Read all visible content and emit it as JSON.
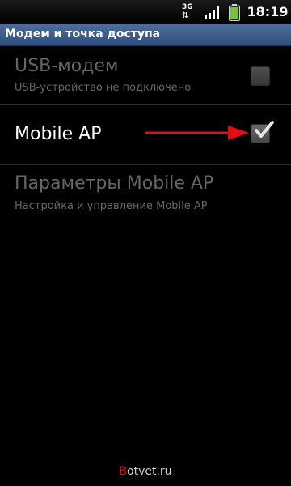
{
  "status_bar": {
    "network_type": "3G",
    "network_arrows": "⇅",
    "time": "18:19",
    "icons": [
      "network-3g-icon",
      "signal-strength-icon",
      "battery-icon"
    ],
    "battery_color": "#76c043"
  },
  "header": {
    "title": "Модем и точка доступа"
  },
  "preferences": [
    {
      "title": "USB-модем",
      "summary": "USB-устройство не подключено",
      "enabled": false,
      "checked": false
    },
    {
      "title": "Mobile AP",
      "summary": "",
      "enabled": true,
      "checked": true
    },
    {
      "title": "Параметры Mobile AP",
      "summary": "Настройка и управление Mobile AP",
      "enabled": false
    }
  ],
  "annotation": {
    "arrow_color": "#e01010"
  },
  "watermark": {
    "prefix": "B",
    "rest": "otvet.ru"
  },
  "colors": {
    "title_bar": "#3d5d8c",
    "background": "#000000",
    "disabled_text": "#666666"
  }
}
